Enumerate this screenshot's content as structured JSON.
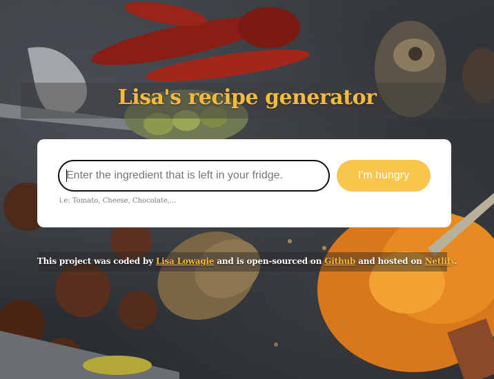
{
  "page": {
    "title": "Lisa's recipe generator"
  },
  "search": {
    "placeholder": "Enter the ingredient that is left in your fridge.",
    "value": "",
    "hint": "i.e: Tomato, Cheese, Chocolate,...",
    "button_label": "I'm hungry"
  },
  "footer": {
    "text_before": "This project was coded by ",
    "author_link": "Lisa Lowagie",
    "text_middle": " and is open-sourced on ",
    "github_link": "Github",
    "text_after": " and hosted on ",
    "netlify_link": "Netlify",
    "text_end": "."
  },
  "colors": {
    "accent": "#f7b93e",
    "button": "#f9c54c",
    "card": "#ffffff",
    "background": "#2e3236"
  }
}
